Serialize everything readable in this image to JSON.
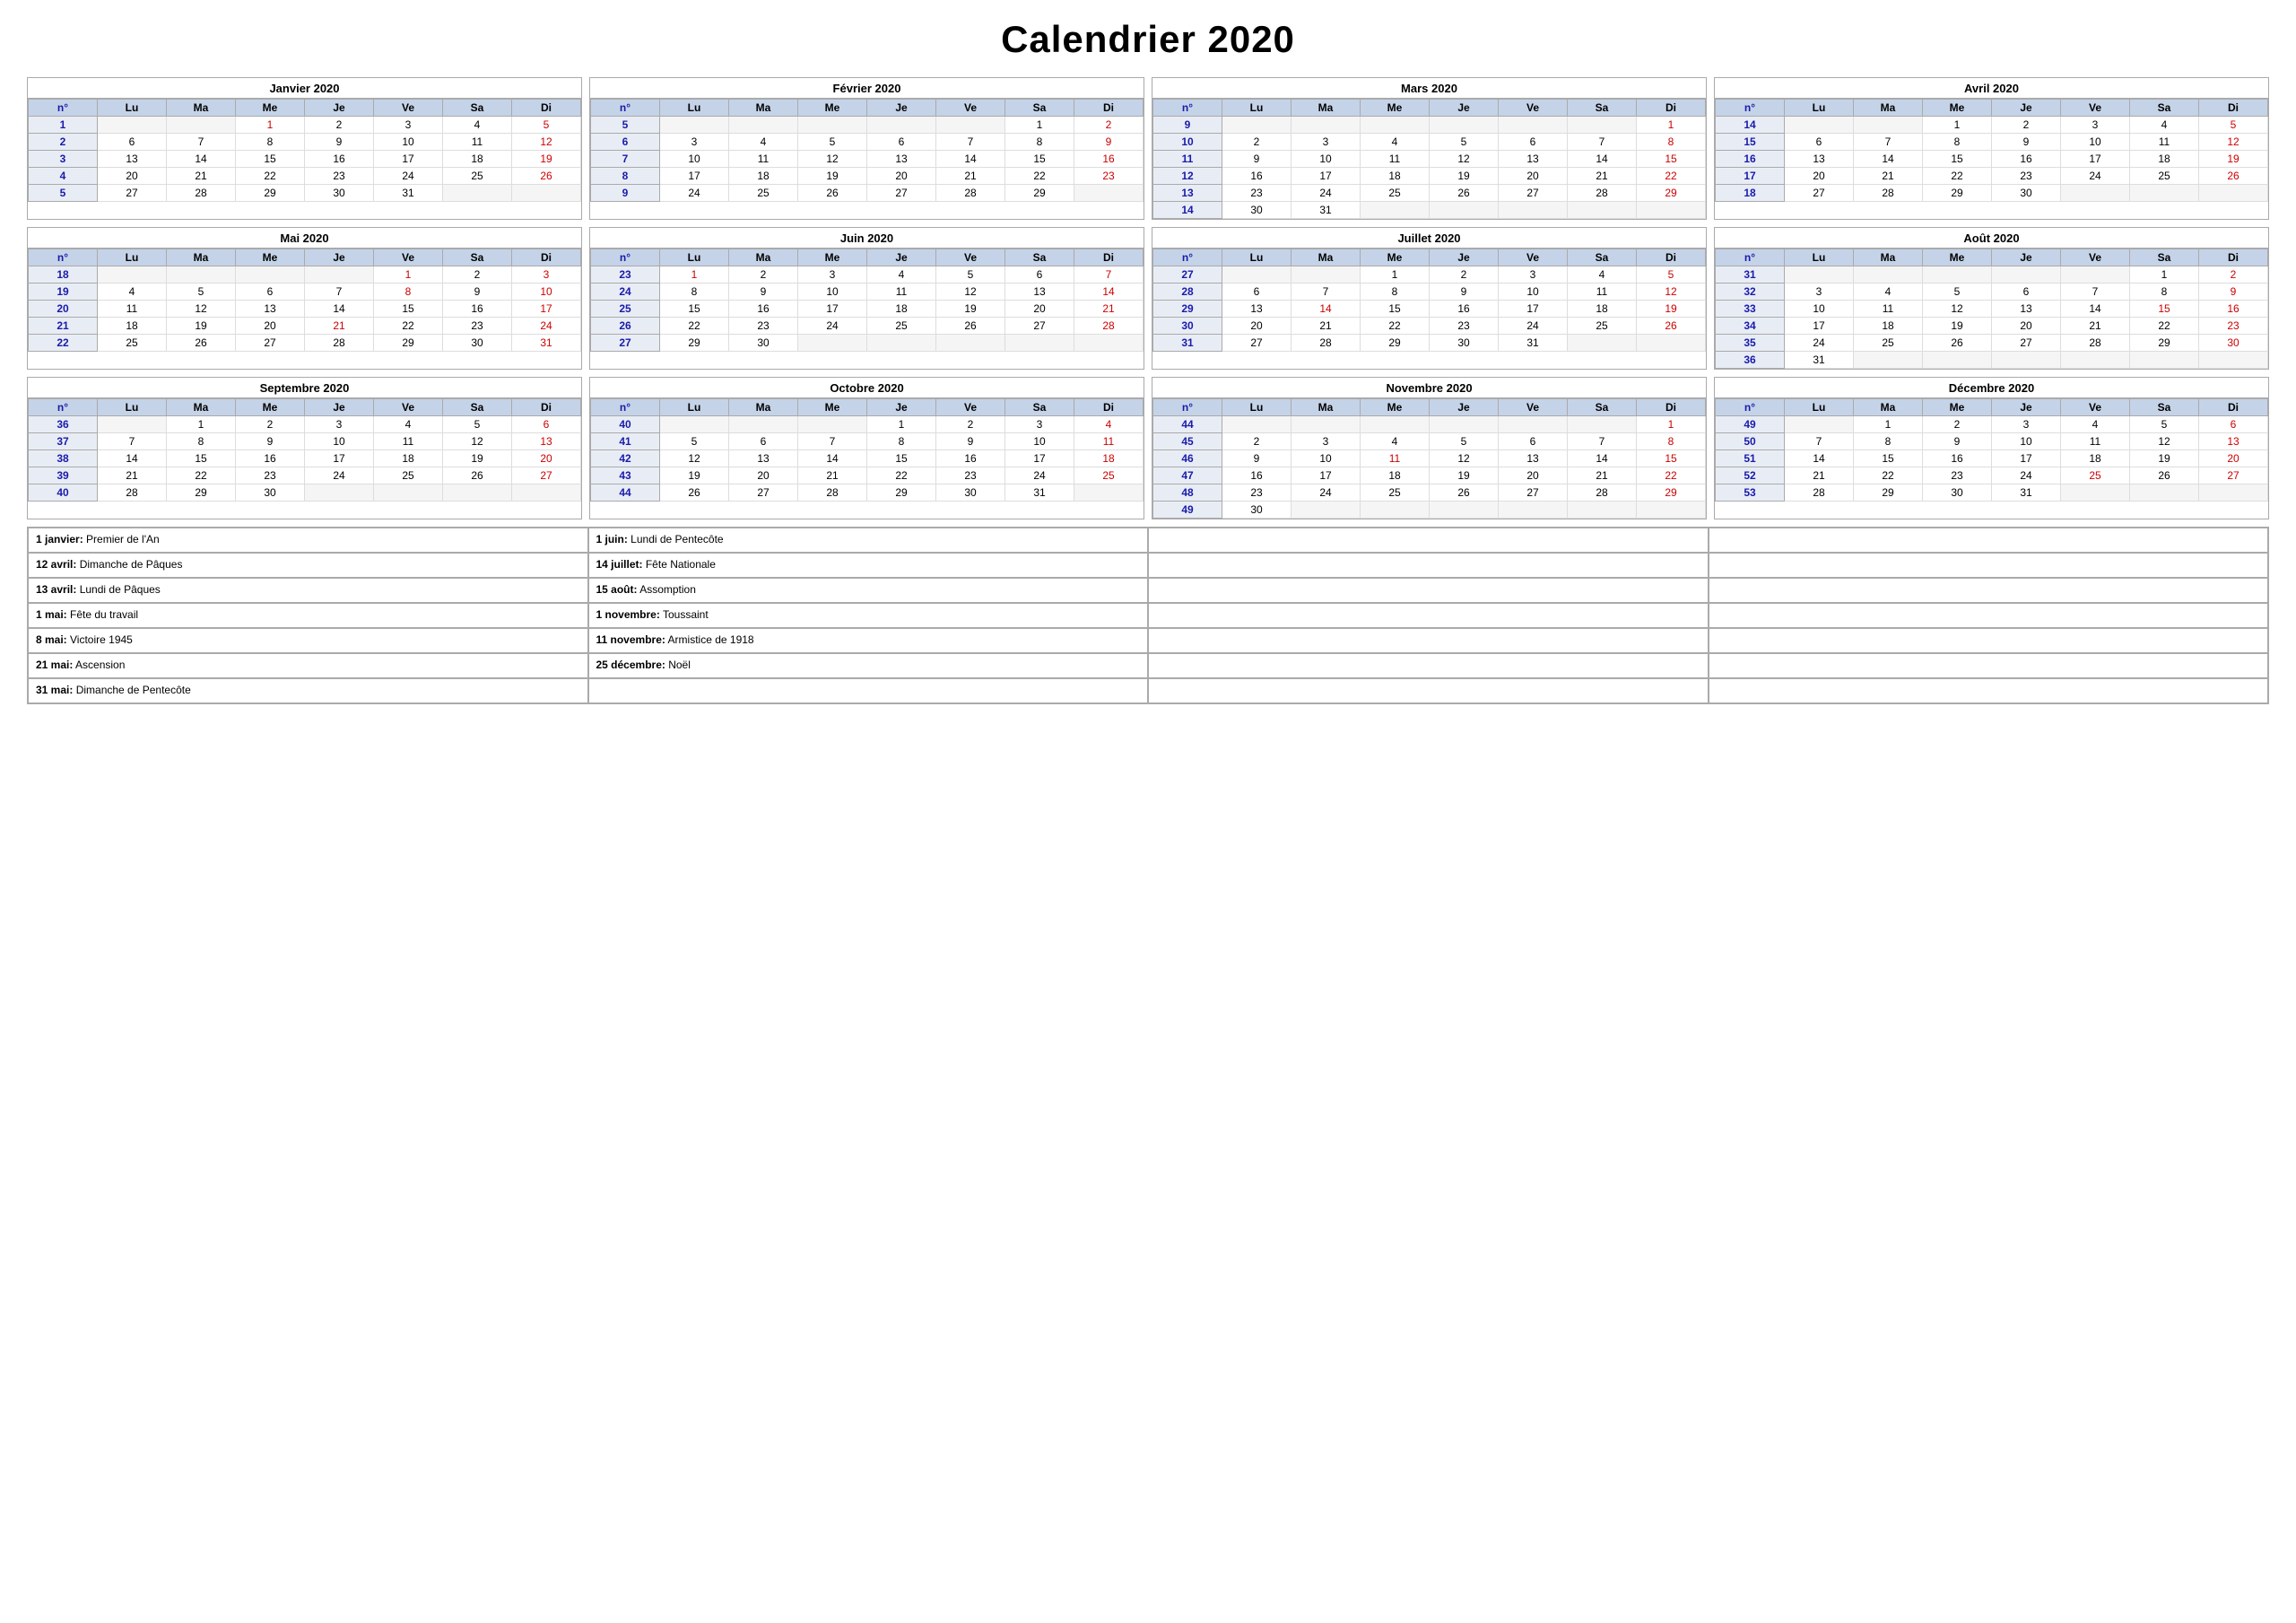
{
  "title": "Calendrier 2020",
  "months": [
    {
      "name": "Janvier 2020",
      "weeks": [
        {
          "num": 1,
          "days": [
            "",
            "",
            "1",
            "2",
            "3",
            "4",
            "5"
          ]
        },
        {
          "num": 2,
          "days": [
            "6",
            "7",
            "8",
            "9",
            "10",
            "11",
            "12"
          ]
        },
        {
          "num": 3,
          "days": [
            "13",
            "14",
            "15",
            "16",
            "17",
            "18",
            "19"
          ]
        },
        {
          "num": 4,
          "days": [
            "20",
            "21",
            "22",
            "23",
            "24",
            "25",
            "26"
          ]
        },
        {
          "num": 5,
          "days": [
            "27",
            "28",
            "29",
            "30",
            "31",
            "",
            ""
          ]
        }
      ],
      "red_days": {
        "wed": [
          "1"
        ]
      }
    },
    {
      "name": "Février 2020",
      "weeks": [
        {
          "num": 5,
          "days": [
            "",
            "",
            "",
            "",
            "",
            "1",
            "2"
          ]
        },
        {
          "num": 6,
          "days": [
            "3",
            "4",
            "5",
            "6",
            "7",
            "8",
            "9"
          ]
        },
        {
          "num": 7,
          "days": [
            "10",
            "11",
            "12",
            "13",
            "14",
            "15",
            "16"
          ]
        },
        {
          "num": 8,
          "days": [
            "17",
            "18",
            "19",
            "20",
            "21",
            "22",
            "23"
          ]
        },
        {
          "num": 9,
          "days": [
            "24",
            "25",
            "26",
            "27",
            "28",
            "29",
            ""
          ]
        }
      ],
      "red_days": {}
    },
    {
      "name": "Mars 2020",
      "weeks": [
        {
          "num": 9,
          "days": [
            "",
            "",
            "",
            "",
            "",
            "",
            "1"
          ]
        },
        {
          "num": 10,
          "days": [
            "2",
            "3",
            "4",
            "5",
            "6",
            "7",
            "8"
          ]
        },
        {
          "num": 11,
          "days": [
            "9",
            "10",
            "11",
            "12",
            "13",
            "14",
            "15"
          ]
        },
        {
          "num": 12,
          "days": [
            "16",
            "17",
            "18",
            "19",
            "20",
            "21",
            "22"
          ]
        },
        {
          "num": 13,
          "days": [
            "23",
            "24",
            "25",
            "26",
            "27",
            "28",
            "29"
          ]
        },
        {
          "num": 14,
          "days": [
            "30",
            "31",
            "",
            "",
            "",
            "",
            ""
          ]
        }
      ],
      "red_days": {}
    },
    {
      "name": "Avril 2020",
      "weeks": [
        {
          "num": 14,
          "days": [
            "",
            "",
            "1",
            "2",
            "3",
            "4",
            "5"
          ]
        },
        {
          "num": 15,
          "days": [
            "6",
            "7",
            "8",
            "9",
            "10",
            "11",
            "12"
          ]
        },
        {
          "num": 16,
          "days": [
            "13",
            "14",
            "15",
            "16",
            "17",
            "18",
            "19"
          ]
        },
        {
          "num": 17,
          "days": [
            "20",
            "21",
            "22",
            "23",
            "24",
            "25",
            "26"
          ]
        },
        {
          "num": 18,
          "days": [
            "27",
            "28",
            "29",
            "30",
            "",
            "",
            ""
          ]
        }
      ],
      "red_days": {
        "sun": [
          "12",
          "19",
          "26",
          "5"
        ],
        "special": {
          "12": "red"
        }
      }
    },
    {
      "name": "Mai 2020",
      "weeks": [
        {
          "num": 18,
          "days": [
            "",
            "",
            "",
            "",
            "1",
            "2",
            "3"
          ]
        },
        {
          "num": 19,
          "days": [
            "4",
            "5",
            "6",
            "7",
            "8",
            "9",
            "10"
          ]
        },
        {
          "num": 20,
          "days": [
            "11",
            "12",
            "13",
            "14",
            "15",
            "16",
            "17"
          ]
        },
        {
          "num": 21,
          "days": [
            "18",
            "19",
            "20",
            "21",
            "22",
            "23",
            "24"
          ]
        },
        {
          "num": 22,
          "days": [
            "25",
            "26",
            "27",
            "28",
            "29",
            "30",
            "31"
          ]
        }
      ],
      "red_days": {
        "fri": [
          "1"
        ],
        "thu": [
          "8",
          "21"
        ],
        "sat": [
          "2"
        ],
        "sun": [
          "31"
        ]
      }
    },
    {
      "name": "Juin 2020",
      "weeks": [
        {
          "num": 23,
          "days": [
            "1",
            "2",
            "3",
            "4",
            "5",
            "6",
            "7"
          ]
        },
        {
          "num": 24,
          "days": [
            "8",
            "9",
            "10",
            "11",
            "12",
            "13",
            "14"
          ]
        },
        {
          "num": 25,
          "days": [
            "15",
            "16",
            "17",
            "18",
            "19",
            "20",
            "21"
          ]
        },
        {
          "num": 26,
          "days": [
            "22",
            "23",
            "24",
            "25",
            "26",
            "27",
            "28"
          ]
        },
        {
          "num": 27,
          "days": [
            "29",
            "30",
            "",
            "",
            "",
            "",
            ""
          ]
        }
      ],
      "red_days": {
        "mon": [
          "1"
        ]
      }
    },
    {
      "name": "Juillet 2020",
      "weeks": [
        {
          "num": 27,
          "days": [
            "",
            "",
            "1",
            "2",
            "3",
            "4",
            "5"
          ]
        },
        {
          "num": 28,
          "days": [
            "6",
            "7",
            "8",
            "9",
            "10",
            "11",
            "12"
          ]
        },
        {
          "num": 29,
          "days": [
            "13",
            "14",
            "15",
            "16",
            "17",
            "18",
            "19"
          ]
        },
        {
          "num": 30,
          "days": [
            "20",
            "21",
            "22",
            "23",
            "24",
            "25",
            "26"
          ]
        },
        {
          "num": 31,
          "days": [
            "27",
            "28",
            "29",
            "30",
            "31",
            "",
            ""
          ]
        }
      ],
      "red_days": {
        "tue": [
          "14"
        ]
      }
    },
    {
      "name": "Août 2020",
      "weeks": [
        {
          "num": 31,
          "days": [
            "",
            "",
            "",
            "",
            "",
            "1",
            "2"
          ]
        },
        {
          "num": 32,
          "days": [
            "3",
            "4",
            "5",
            "6",
            "7",
            "8",
            "9"
          ]
        },
        {
          "num": 33,
          "days": [
            "10",
            "11",
            "12",
            "13",
            "14",
            "15",
            "16"
          ]
        },
        {
          "num": 34,
          "days": [
            "17",
            "18",
            "19",
            "20",
            "21",
            "22",
            "23"
          ]
        },
        {
          "num": 35,
          "days": [
            "24",
            "25",
            "26",
            "27",
            "28",
            "29",
            "30"
          ]
        },
        {
          "num": 36,
          "days": [
            "31",
            "",
            "",
            "",
            "",
            "",
            ""
          ]
        }
      ],
      "red_days": {
        "sat": [
          "15"
        ]
      }
    },
    {
      "name": "Septembre 2020",
      "weeks": [
        {
          "num": 36,
          "days": [
            "",
            "1",
            "2",
            "3",
            "4",
            "5",
            "6"
          ]
        },
        {
          "num": 37,
          "days": [
            "7",
            "8",
            "9",
            "10",
            "11",
            "12",
            "13"
          ]
        },
        {
          "num": 38,
          "days": [
            "14",
            "15",
            "16",
            "17",
            "18",
            "19",
            "20"
          ]
        },
        {
          "num": 39,
          "days": [
            "21",
            "22",
            "23",
            "24",
            "25",
            "26",
            "27"
          ]
        },
        {
          "num": 40,
          "days": [
            "28",
            "29",
            "30",
            "",
            "",
            "",
            ""
          ]
        }
      ],
      "red_days": {}
    },
    {
      "name": "Octobre 2020",
      "weeks": [
        {
          "num": 40,
          "days": [
            "",
            "",
            "",
            "1",
            "2",
            "3",
            "4"
          ]
        },
        {
          "num": 41,
          "days": [
            "5",
            "6",
            "7",
            "8",
            "9",
            "10",
            "11"
          ]
        },
        {
          "num": 42,
          "days": [
            "12",
            "13",
            "14",
            "15",
            "16",
            "17",
            "18"
          ]
        },
        {
          "num": 43,
          "days": [
            "19",
            "20",
            "21",
            "22",
            "23",
            "24",
            "25"
          ]
        },
        {
          "num": 44,
          "days": [
            "26",
            "27",
            "28",
            "29",
            "30",
            "31",
            ""
          ]
        }
      ],
      "red_days": {}
    },
    {
      "name": "Novembre 2020",
      "weeks": [
        {
          "num": 44,
          "days": [
            "",
            "",
            "",
            "",
            "",
            "",
            "1"
          ]
        },
        {
          "num": 45,
          "days": [
            "2",
            "3",
            "4",
            "5",
            "6",
            "7",
            "8"
          ]
        },
        {
          "num": 46,
          "days": [
            "9",
            "10",
            "11",
            "12",
            "13",
            "14",
            "15"
          ]
        },
        {
          "num": 47,
          "days": [
            "16",
            "17",
            "18",
            "19",
            "20",
            "21",
            "22"
          ]
        },
        {
          "num": 48,
          "days": [
            "23",
            "24",
            "25",
            "26",
            "27",
            "28",
            "29"
          ]
        },
        {
          "num": 49,
          "days": [
            "30",
            "",
            "",
            "",
            "",
            "",
            ""
          ]
        }
      ],
      "red_days": {
        "sun": [
          "1"
        ],
        "wed": [
          "11"
        ]
      }
    },
    {
      "name": "Décembre 2020",
      "weeks": [
        {
          "num": 49,
          "days": [
            "",
            "1",
            "2",
            "3",
            "4",
            "5",
            "6"
          ]
        },
        {
          "num": 50,
          "days": [
            "7",
            "8",
            "9",
            "10",
            "11",
            "12",
            "13"
          ]
        },
        {
          "num": 51,
          "days": [
            "14",
            "15",
            "16",
            "17",
            "18",
            "19",
            "20"
          ]
        },
        {
          "num": 52,
          "days": [
            "21",
            "22",
            "23",
            "24",
            "25",
            "26",
            "27"
          ]
        },
        {
          "num": 53,
          "days": [
            "28",
            "29",
            "30",
            "31",
            "",
            "",
            ""
          ]
        }
      ],
      "red_days": {
        "fri": [
          "25"
        ]
      }
    }
  ],
  "day_headers": [
    "n°",
    "Lu",
    "Ma",
    "Me",
    "Je",
    "Ve",
    "Sa",
    "Di"
  ],
  "holidays": [
    [
      {
        "bold": "1 janvier:",
        "text": " Premier de l'An"
      },
      {
        "bold": "1 juin:",
        "text": " Lundi de Pentecôte"
      },
      {
        "bold": "",
        "text": ""
      },
      {
        "bold": "",
        "text": ""
      }
    ],
    [
      {
        "bold": "12 avril:",
        "text": " Dimanche de Pâques"
      },
      {
        "bold": "14 juillet:",
        "text": " Fête Nationale"
      },
      {
        "bold": "",
        "text": ""
      },
      {
        "bold": "",
        "text": ""
      }
    ],
    [
      {
        "bold": "13 avril:",
        "text": " Lundi de Pâques"
      },
      {
        "bold": "15 août:",
        "text": " Assomption"
      },
      {
        "bold": "",
        "text": ""
      },
      {
        "bold": "",
        "text": ""
      }
    ],
    [
      {
        "bold": "1 mai:",
        "text": " Fête du travail"
      },
      {
        "bold": "1 novembre:",
        "text": " Toussaint"
      },
      {
        "bold": "",
        "text": ""
      },
      {
        "bold": "",
        "text": ""
      }
    ],
    [
      {
        "bold": "8 mai:",
        "text": " Victoire 1945"
      },
      {
        "bold": "11 novembre:",
        "text": " Armistice de 1918"
      },
      {
        "bold": "",
        "text": ""
      },
      {
        "bold": "",
        "text": ""
      }
    ],
    [
      {
        "bold": "21 mai:",
        "text": " Ascension"
      },
      {
        "bold": "25 décembre:",
        "text": " Noël"
      },
      {
        "bold": "",
        "text": ""
      },
      {
        "bold": "",
        "text": ""
      }
    ],
    [
      {
        "bold": "31 mai:",
        "text": " Dimanche de Pentecôte"
      },
      {
        "bold": "",
        "text": ""
      },
      {
        "bold": "",
        "text": ""
      },
      {
        "bold": "",
        "text": ""
      }
    ]
  ]
}
